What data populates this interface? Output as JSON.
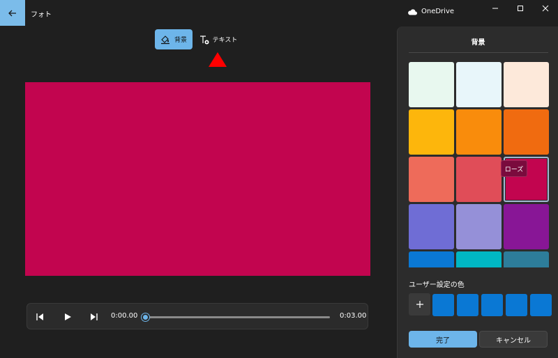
{
  "app": {
    "title": "フォト",
    "onedrive_label": "OneDrive"
  },
  "toolbar": {
    "background_label": "背景",
    "text_label": "テキスト"
  },
  "canvas": {
    "color": "#c2054f"
  },
  "player": {
    "current_time": "0:00.00",
    "total_time": "0:03.00",
    "progress": 0
  },
  "panel": {
    "title": "背景",
    "swatches": [
      {
        "color": "#e8f8ef"
      },
      {
        "color": "#e8f6fa"
      },
      {
        "color": "#fde9da"
      },
      {
        "color": "#fdb60c"
      },
      {
        "color": "#f98c0c"
      },
      {
        "color": "#f06b10"
      },
      {
        "color": "#ee6b5a"
      },
      {
        "color": "#e04d58"
      },
      {
        "color": "#c2054f",
        "name": "ローズ",
        "selected": true
      },
      {
        "color": "#6f6dd5"
      },
      {
        "color": "#9590d8"
      },
      {
        "color": "#881696"
      },
      {
        "color": "#0a78d4"
      },
      {
        "color": "#00b7c3"
      },
      {
        "color": "#2d7d9a"
      }
    ],
    "tooltip": "ローズ",
    "custom_label": "ユーザー設定の色",
    "custom_colors": [
      "#0a78d4",
      "#0a78d4",
      "#0a78d4",
      "#0a78d4",
      "#0a78d4"
    ],
    "done_label": "完了",
    "cancel_label": "キャンセル"
  },
  "colors": {
    "accent": "#6db5ea",
    "annotation_arrow": "#ff0000"
  }
}
